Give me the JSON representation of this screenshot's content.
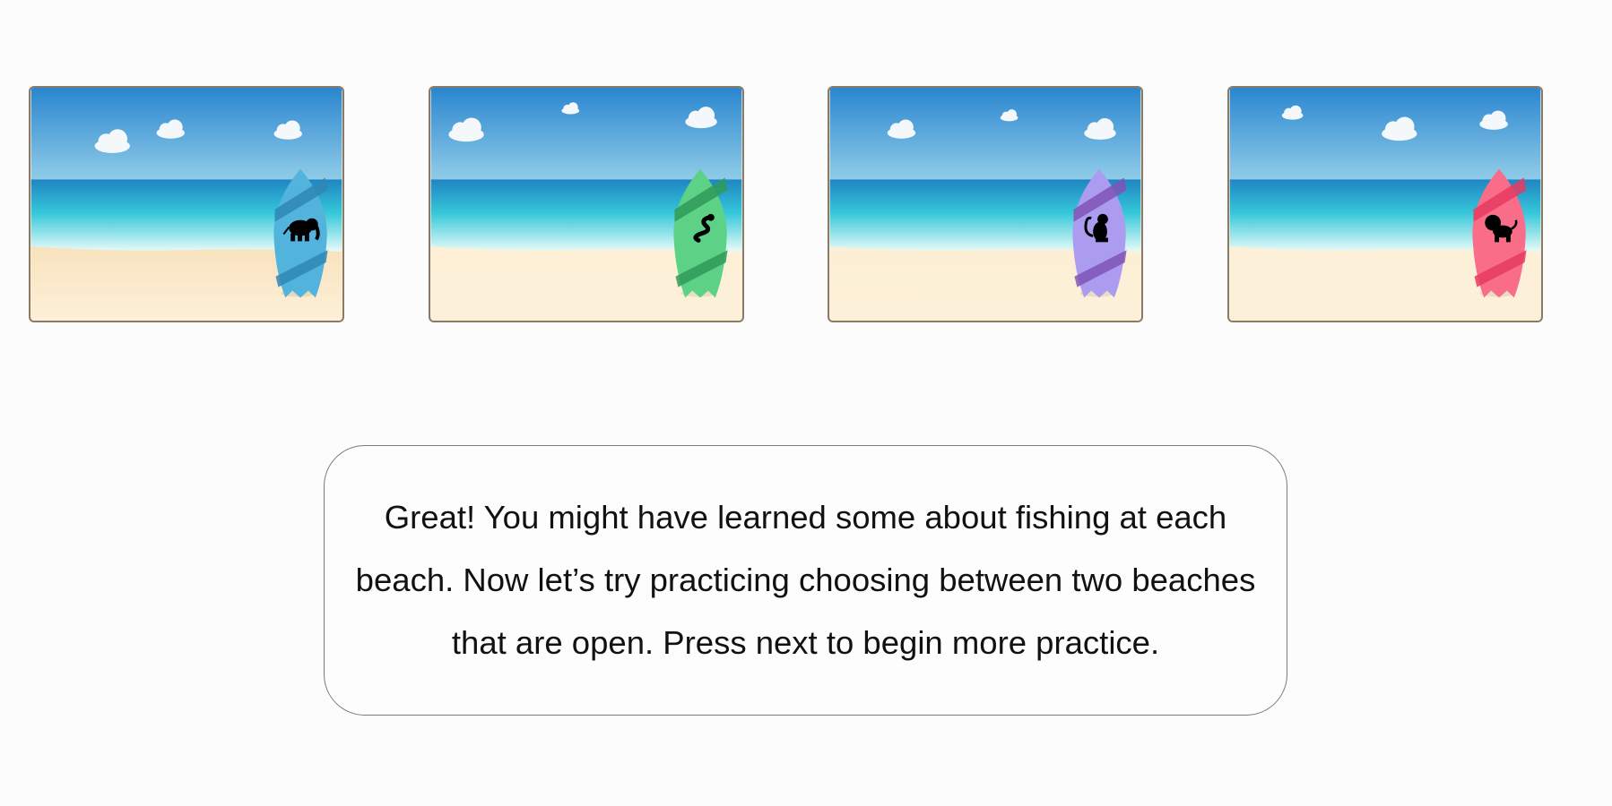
{
  "beaches": [
    {
      "animal": "elephant",
      "board_color": "#52b3dd",
      "stripe_color": "#2f87b4",
      "sand_color": "#f8e2bd"
    },
    {
      "animal": "snake",
      "board_color": "#5dd185",
      "stripe_color": "#2f9a58",
      "sand_color": "#fdf0d7"
    },
    {
      "animal": "monkey",
      "board_color": "#ab9cf0",
      "stripe_color": "#7f53b6",
      "sand_color": "#fcefd6"
    },
    {
      "animal": "lion",
      "board_color": "#f96d89",
      "stripe_color": "#e83960",
      "sand_color": "#fdf0d9"
    }
  ],
  "message": {
    "text": "Great! You might have learned some about fishing at each beach. Now let’s try practicing choosing between two beaches that are open. Press next to begin more practice."
  }
}
